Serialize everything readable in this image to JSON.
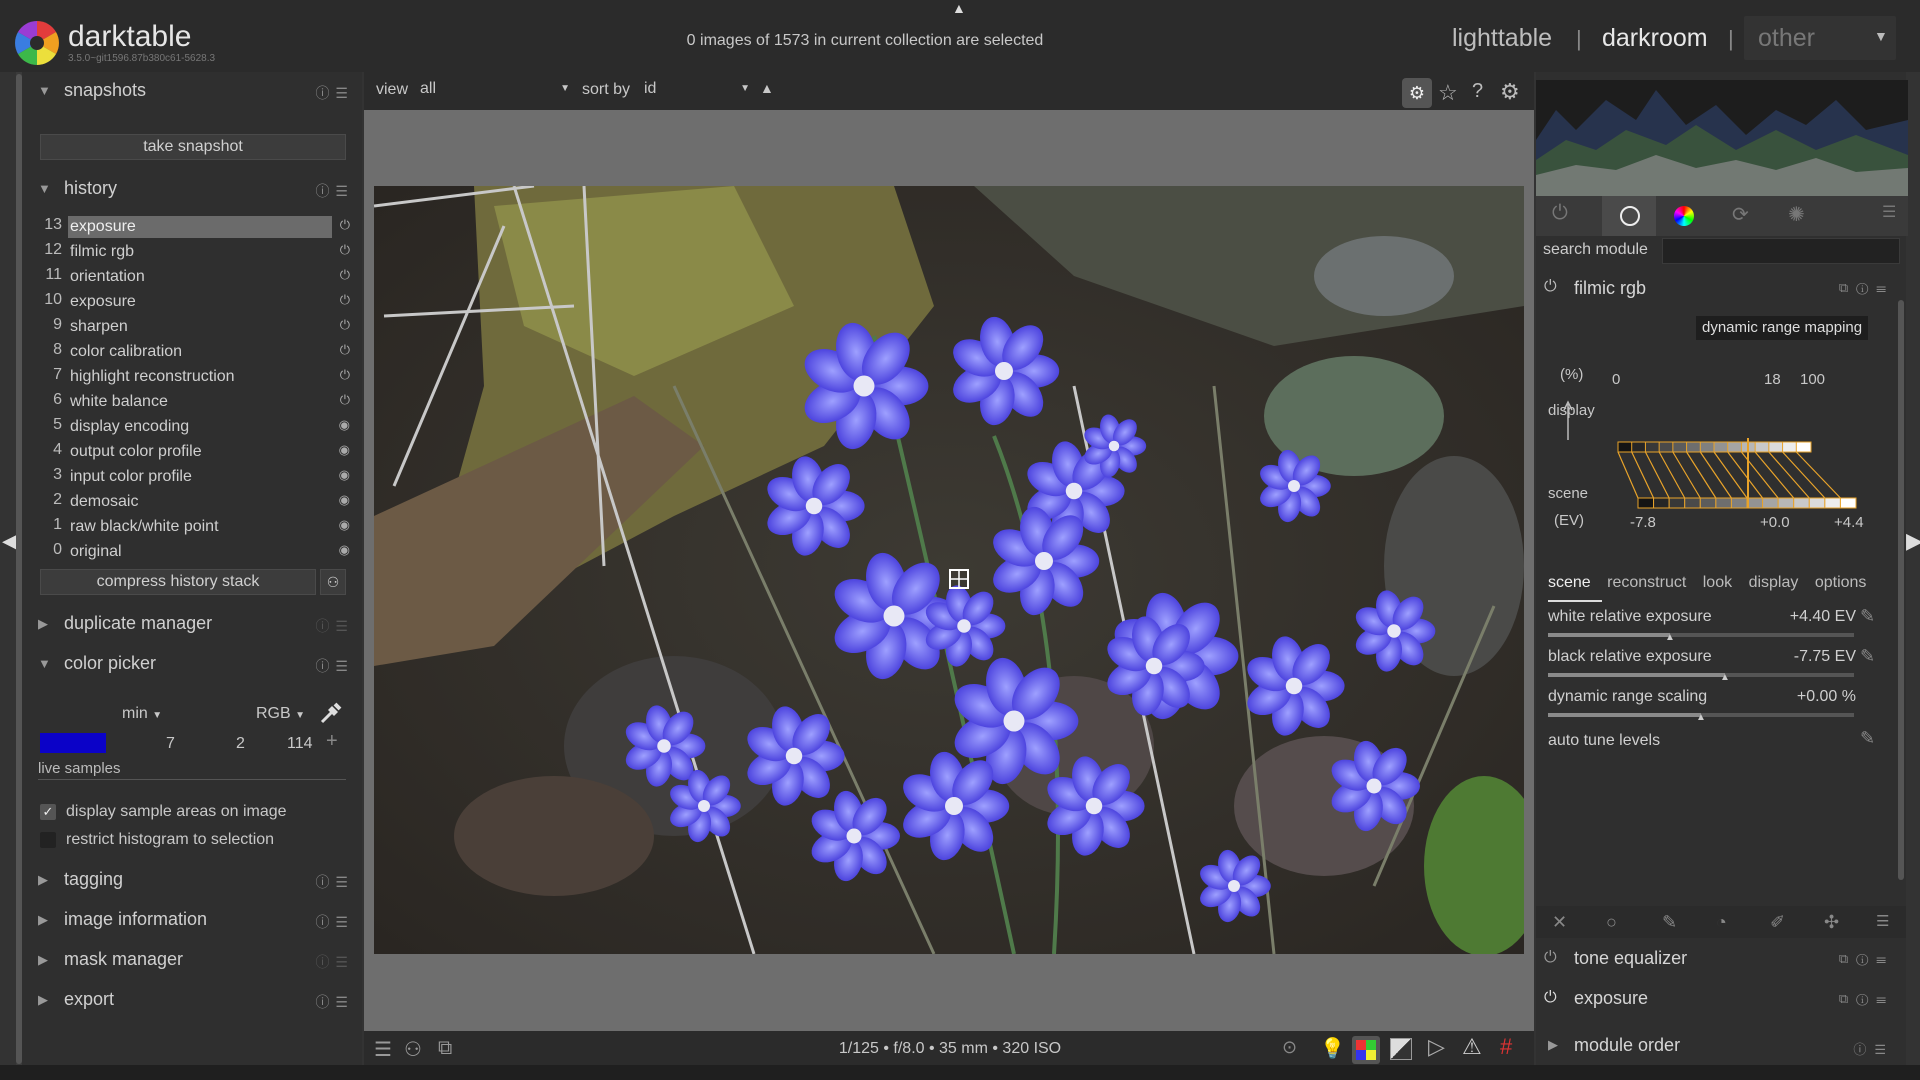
{
  "app": {
    "name": "darktable",
    "version": "3.5.0~git1596.87b380c61-5628.3"
  },
  "header": {
    "selection_status": "0 images of 1573 in current collection are selected",
    "views": [
      "lighttable",
      "darkroom",
      "other"
    ],
    "separator": "|"
  },
  "left": {
    "snapshots": {
      "title": "snapshots",
      "take_label": "take snapshot"
    },
    "history": {
      "title": "history",
      "items": [
        {
          "num": "13",
          "label": "exposure"
        },
        {
          "num": "12",
          "label": "filmic rgb"
        },
        {
          "num": "11",
          "label": "orientation"
        },
        {
          "num": "10",
          "label": "exposure"
        },
        {
          "num": "9",
          "label": "sharpen"
        },
        {
          "num": "8",
          "label": "color calibration"
        },
        {
          "num": "7",
          "label": "highlight reconstruction"
        },
        {
          "num": "6",
          "label": "white balance"
        },
        {
          "num": "5",
          "label": "display encoding"
        },
        {
          "num": "4",
          "label": "output color profile"
        },
        {
          "num": "3",
          "label": "input color profile"
        },
        {
          "num": "2",
          "label": "demosaic"
        },
        {
          "num": "1",
          "label": "raw black/white point"
        },
        {
          "num": "0",
          "label": "original"
        }
      ],
      "compress_label": "compress history stack"
    },
    "duplicate_manager": {
      "title": "duplicate manager"
    },
    "color_picker": {
      "title": "color picker",
      "mode": "min",
      "space": "RGB",
      "swatch_color": "#0b02c8",
      "values": [
        "7",
        "2",
        "114"
      ],
      "live_samples": "live samples",
      "opt1": "display sample areas on image",
      "opt2": "restrict histogram to selection"
    },
    "tagging": {
      "title": "tagging"
    },
    "image_information": {
      "title": "image information"
    },
    "mask_manager": {
      "title": "mask manager"
    },
    "export": {
      "title": "export"
    }
  },
  "center": {
    "view_label": "view",
    "view_value": "all",
    "sort_label": "sort by",
    "sort_value": "id",
    "exif": "1/125 • f/8.0 • 35 mm • 320 ISO"
  },
  "right": {
    "search_label": "search module",
    "filmic": {
      "title": "filmic rgb",
      "graph_title": "dynamic range mapping",
      "pct": "(%)",
      "display": "display",
      "scene": "scene",
      "ev": "(EV)",
      "top_ticks": [
        "0",
        "18",
        "100"
      ],
      "bottom_ticks": [
        "-7.8",
        "+0.0",
        "+4.4"
      ],
      "tabs": [
        "scene",
        "reconstruct",
        "look",
        "display",
        "options"
      ],
      "sliders": [
        {
          "label": "white relative exposure",
          "value": "+4.40 EV",
          "fraction": 0.4
        },
        {
          "label": "black relative exposure",
          "value": "-7.75 EV",
          "fraction": 0.58
        },
        {
          "label": "dynamic range scaling",
          "value": "+0.00 %",
          "fraction": 0.5
        }
      ],
      "auto_tune": "auto tune levels"
    },
    "modules": [
      "tone equalizer",
      "exposure"
    ],
    "module_order": "module order"
  },
  "colors": {
    "accent": "#e8a32a",
    "panel_bg": "#2f2f2f",
    "topbar_bg": "#2b2b2b"
  }
}
